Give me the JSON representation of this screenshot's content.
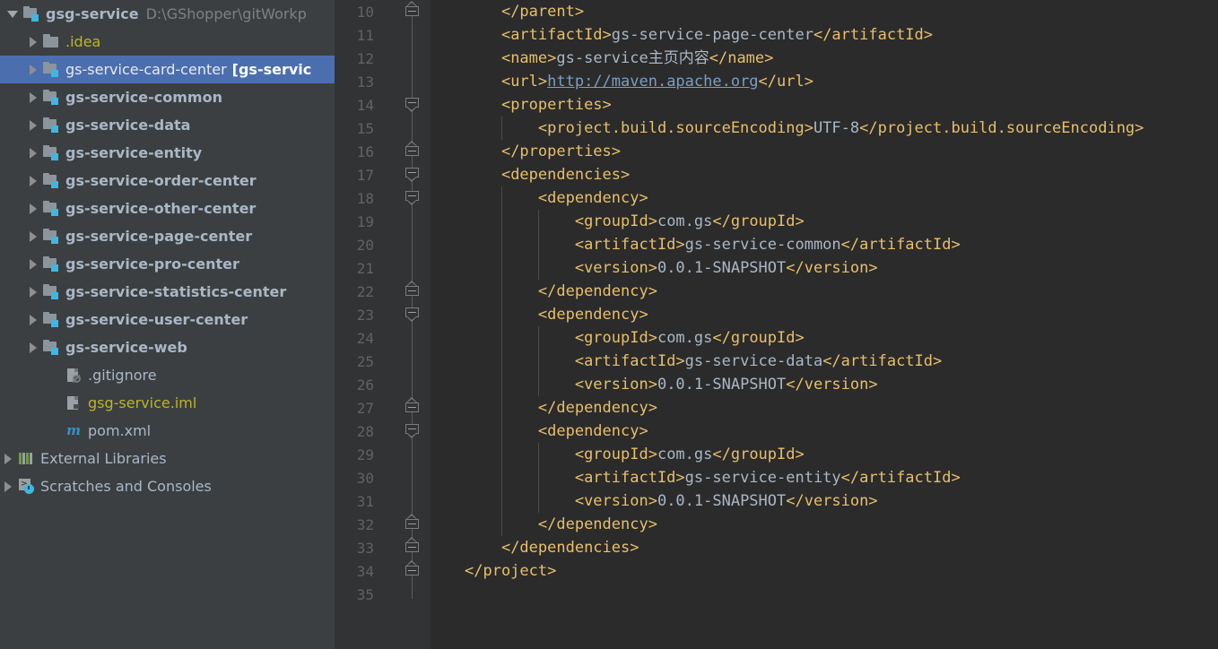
{
  "sidebar": {
    "name": "project-tree",
    "rows": [
      {
        "id": "gsg-service",
        "label": "gsg-service",
        "path": "D:\\GShopper\\gitWorkp",
        "icon": "module-folder-icon",
        "arrow": "down",
        "indent": 8,
        "style": "bold",
        "selected": false
      },
      {
        "id": "idea",
        "label": ".idea",
        "path": "",
        "icon": "folder-icon",
        "arrow": "right",
        "indent": 30,
        "style": "yellow",
        "selected": false
      },
      {
        "id": "gs-service-card-center",
        "label": "gs-service-card-center",
        "suffix": "[gs-servic",
        "path": "",
        "icon": "module-folder-icon",
        "arrow": "right",
        "indent": 30,
        "style": "selected",
        "selected": true
      },
      {
        "id": "gs-service-common",
        "label": "gs-service-common",
        "path": "",
        "icon": "module-folder-icon",
        "arrow": "right",
        "indent": 30,
        "style": "bold",
        "selected": false
      },
      {
        "id": "gs-service-data",
        "label": "gs-service-data",
        "path": "",
        "icon": "module-folder-icon",
        "arrow": "right",
        "indent": 30,
        "style": "bold",
        "selected": false
      },
      {
        "id": "gs-service-entity",
        "label": "gs-service-entity",
        "path": "",
        "icon": "module-folder-icon",
        "arrow": "right",
        "indent": 30,
        "style": "bold",
        "selected": false
      },
      {
        "id": "gs-service-order-center",
        "label": "gs-service-order-center",
        "path": "",
        "icon": "module-folder-icon",
        "arrow": "right",
        "indent": 30,
        "style": "bold",
        "selected": false
      },
      {
        "id": "gs-service-other-center",
        "label": "gs-service-other-center",
        "path": "",
        "icon": "module-folder-icon",
        "arrow": "right",
        "indent": 30,
        "style": "bold",
        "selected": false
      },
      {
        "id": "gs-service-page-center",
        "label": "gs-service-page-center",
        "path": "",
        "icon": "module-folder-icon",
        "arrow": "right",
        "indent": 30,
        "style": "bold",
        "selected": false
      },
      {
        "id": "gs-service-pro-center",
        "label": "gs-service-pro-center",
        "path": "",
        "icon": "module-folder-icon",
        "arrow": "right",
        "indent": 30,
        "style": "bold",
        "selected": false
      },
      {
        "id": "gs-service-statistics-center",
        "label": "gs-service-statistics-center",
        "path": "",
        "icon": "module-folder-icon",
        "arrow": "right",
        "indent": 30,
        "style": "bold",
        "selected": false
      },
      {
        "id": "gs-service-user-center",
        "label": "gs-service-user-center",
        "path": "",
        "icon": "module-folder-icon",
        "arrow": "right",
        "indent": 30,
        "style": "bold",
        "selected": false
      },
      {
        "id": "gs-service-web",
        "label": "gs-service-web",
        "path": "",
        "icon": "module-folder-icon",
        "arrow": "right",
        "indent": 30,
        "style": "bold",
        "selected": false
      },
      {
        "id": "gitignore",
        "label": ".gitignore",
        "path": "",
        "icon": "gitignore-file-icon",
        "arrow": "none",
        "indent": 55,
        "style": "plain",
        "selected": false
      },
      {
        "id": "gsg-service-iml",
        "label": "gsg-service.iml",
        "path": "",
        "icon": "iml-file-icon",
        "arrow": "none",
        "indent": 55,
        "style": "yellow",
        "selected": false
      },
      {
        "id": "pom-xml",
        "label": "pom.xml",
        "path": "",
        "icon": "maven-file-icon",
        "arrow": "none",
        "indent": 55,
        "style": "plain",
        "selected": false
      },
      {
        "id": "external-libraries",
        "label": "External Libraries",
        "path": "",
        "icon": "libraries-icon",
        "arrow": "right",
        "indent": 2,
        "style": "plain",
        "selected": false
      },
      {
        "id": "scratches-and-consoles",
        "label": "Scratches and Consoles",
        "path": "",
        "icon": "scratches-icon",
        "arrow": "right",
        "indent": 2,
        "style": "plain",
        "selected": false
      }
    ]
  },
  "editor": {
    "name": "pom-xml-editor",
    "first_line": 10,
    "line_height": 26,
    "lines": [
      {
        "n": 10,
        "indent": 4,
        "parts": [
          {
            "t": "tag",
            "s": "</parent>"
          }
        ]
      },
      {
        "n": 11,
        "indent": 4,
        "parts": [
          {
            "t": "tag",
            "s": "<artifactId>"
          },
          {
            "t": "txt",
            "s": "gs-service-page-center"
          },
          {
            "t": "tag",
            "s": "</artifactId>"
          }
        ]
      },
      {
        "n": 12,
        "indent": 4,
        "parts": [
          {
            "t": "tag",
            "s": "<name>"
          },
          {
            "t": "txt",
            "s": "gs-service主页内容"
          },
          {
            "t": "tag",
            "s": "</name>"
          }
        ]
      },
      {
        "n": 13,
        "indent": 4,
        "parts": [
          {
            "t": "tag",
            "s": "<url>"
          },
          {
            "t": "link",
            "s": "http://maven.apache.org"
          },
          {
            "t": "tag",
            "s": "</url>"
          }
        ]
      },
      {
        "n": 14,
        "indent": 4,
        "parts": [
          {
            "t": "tag",
            "s": "<properties>"
          }
        ]
      },
      {
        "n": 15,
        "indent": 8,
        "parts": [
          {
            "t": "tag",
            "s": "<project.build.sourceEncoding>"
          },
          {
            "t": "txt",
            "s": "UTF-8"
          },
          {
            "t": "tag",
            "s": "</project.build.sourceEncoding>"
          }
        ]
      },
      {
        "n": 16,
        "indent": 4,
        "parts": [
          {
            "t": "tag",
            "s": "</properties>"
          }
        ]
      },
      {
        "n": 17,
        "indent": 4,
        "parts": [
          {
            "t": "tag",
            "s": "<dependencies>"
          }
        ]
      },
      {
        "n": 18,
        "indent": 8,
        "parts": [
          {
            "t": "tag",
            "s": "<dependency>"
          }
        ]
      },
      {
        "n": 19,
        "indent": 12,
        "parts": [
          {
            "t": "tag",
            "s": "<groupId>"
          },
          {
            "t": "txt",
            "s": "com.gs"
          },
          {
            "t": "tag",
            "s": "</groupId>"
          }
        ]
      },
      {
        "n": 20,
        "indent": 12,
        "parts": [
          {
            "t": "tag",
            "s": "<artifactId>"
          },
          {
            "t": "txt",
            "s": "gs-service-common"
          },
          {
            "t": "tag",
            "s": "</artifactId>"
          }
        ]
      },
      {
        "n": 21,
        "indent": 12,
        "parts": [
          {
            "t": "tag",
            "s": "<version>"
          },
          {
            "t": "txt",
            "s": "0.0.1-SNAPSHOT"
          },
          {
            "t": "tag",
            "s": "</version>"
          }
        ]
      },
      {
        "n": 22,
        "indent": 8,
        "parts": [
          {
            "t": "tag",
            "s": "</dependency>"
          }
        ]
      },
      {
        "n": 23,
        "indent": 8,
        "parts": [
          {
            "t": "tag",
            "s": "<dependency>"
          }
        ]
      },
      {
        "n": 24,
        "indent": 12,
        "parts": [
          {
            "t": "tag",
            "s": "<groupId>"
          },
          {
            "t": "txt",
            "s": "com.gs"
          },
          {
            "t": "tag",
            "s": "</groupId>"
          }
        ]
      },
      {
        "n": 25,
        "indent": 12,
        "parts": [
          {
            "t": "tag",
            "s": "<artifactId>"
          },
          {
            "t": "txt",
            "s": "gs-service-data"
          },
          {
            "t": "tag",
            "s": "</artifactId>"
          }
        ]
      },
      {
        "n": 26,
        "indent": 12,
        "parts": [
          {
            "t": "tag",
            "s": "<version>"
          },
          {
            "t": "txt",
            "s": "0.0.1-SNAPSHOT"
          },
          {
            "t": "tag",
            "s": "</version>"
          }
        ]
      },
      {
        "n": 27,
        "indent": 8,
        "parts": [
          {
            "t": "tag",
            "s": "</dependency>"
          }
        ]
      },
      {
        "n": 28,
        "indent": 8,
        "parts": [
          {
            "t": "tag",
            "s": "<dependency>"
          }
        ]
      },
      {
        "n": 29,
        "indent": 12,
        "parts": [
          {
            "t": "tag",
            "s": "<groupId>"
          },
          {
            "t": "txt",
            "s": "com.gs"
          },
          {
            "t": "tag",
            "s": "</groupId>"
          }
        ]
      },
      {
        "n": 30,
        "indent": 12,
        "parts": [
          {
            "t": "tag",
            "s": "<artifactId>"
          },
          {
            "t": "txt",
            "s": "gs-service-entity"
          },
          {
            "t": "tag",
            "s": "</artifactId>"
          }
        ]
      },
      {
        "n": 31,
        "indent": 12,
        "parts": [
          {
            "t": "tag",
            "s": "<version>"
          },
          {
            "t": "txt",
            "s": "0.0.1-SNAPSHOT"
          },
          {
            "t": "tag",
            "s": "</version>"
          }
        ]
      },
      {
        "n": 32,
        "indent": 8,
        "parts": [
          {
            "t": "tag",
            "s": "</dependency>"
          }
        ]
      },
      {
        "n": 33,
        "indent": 4,
        "parts": [
          {
            "t": "tag",
            "s": "</dependencies>"
          }
        ]
      },
      {
        "n": 34,
        "indent": 0,
        "parts": [
          {
            "t": "tag",
            "s": "</project>"
          }
        ]
      },
      {
        "n": 35,
        "indent": 0,
        "parts": []
      }
    ],
    "folds": [
      {
        "line": 10,
        "kind": "end"
      },
      {
        "line": 14,
        "kind": "start"
      },
      {
        "line": 16,
        "kind": "end"
      },
      {
        "line": 17,
        "kind": "start"
      },
      {
        "line": 18,
        "kind": "start"
      },
      {
        "line": 22,
        "kind": "end"
      },
      {
        "line": 23,
        "kind": "start"
      },
      {
        "line": 27,
        "kind": "end"
      },
      {
        "line": 28,
        "kind": "start"
      },
      {
        "line": 32,
        "kind": "end"
      },
      {
        "line": 33,
        "kind": "end"
      },
      {
        "line": 34,
        "kind": "end"
      }
    ]
  },
  "colors": {
    "sidebar_bg": "#3c3f41",
    "editor_bg": "#2b2b2b",
    "gutter_bg": "#313335",
    "selection": "#4b6eaf",
    "tag": "#e8bf6a",
    "text_value": "#a9b7c6",
    "link": "#7a9ec2",
    "iml_yellow": "#bbb529",
    "module_badge": "#40b6e0",
    "line_number": "#606366"
  }
}
